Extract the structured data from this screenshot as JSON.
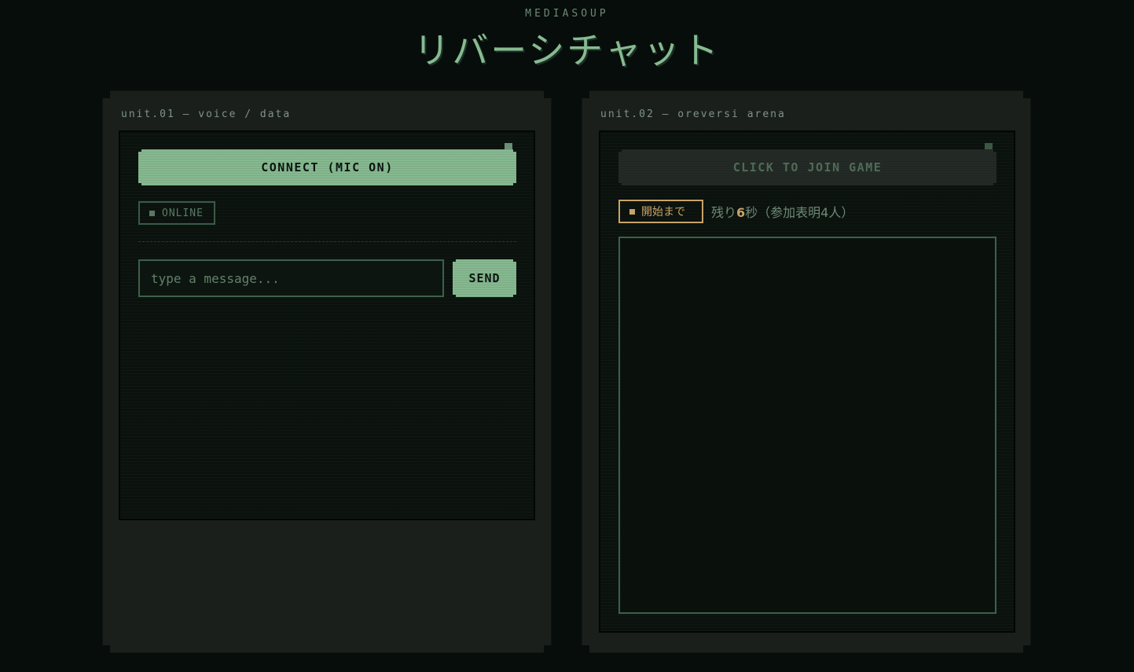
{
  "header": {
    "brand": "MEDIASOUP",
    "title": "リバーシチャット"
  },
  "unit1": {
    "label": "unit.01 — voice / data",
    "connect_label": "CONNECT (MIC ON)",
    "status_label": "ONLINE",
    "message_placeholder": "type a message...",
    "send_label": "SEND"
  },
  "unit2": {
    "label": "unit.02 — oreversi arena",
    "join_label": "CLICK TO JOIN GAME",
    "countdown_badge": "開始まで",
    "countdown_prefix": "残り",
    "countdown_seconds": "6",
    "countdown_suffix": "秒（参加表明4人）"
  },
  "colors": {
    "background": "#070d0a",
    "panel": "#1a1f1c",
    "screen": "#0b120e",
    "accent_green": "#86b990",
    "accent_gold": "#c9a368"
  }
}
